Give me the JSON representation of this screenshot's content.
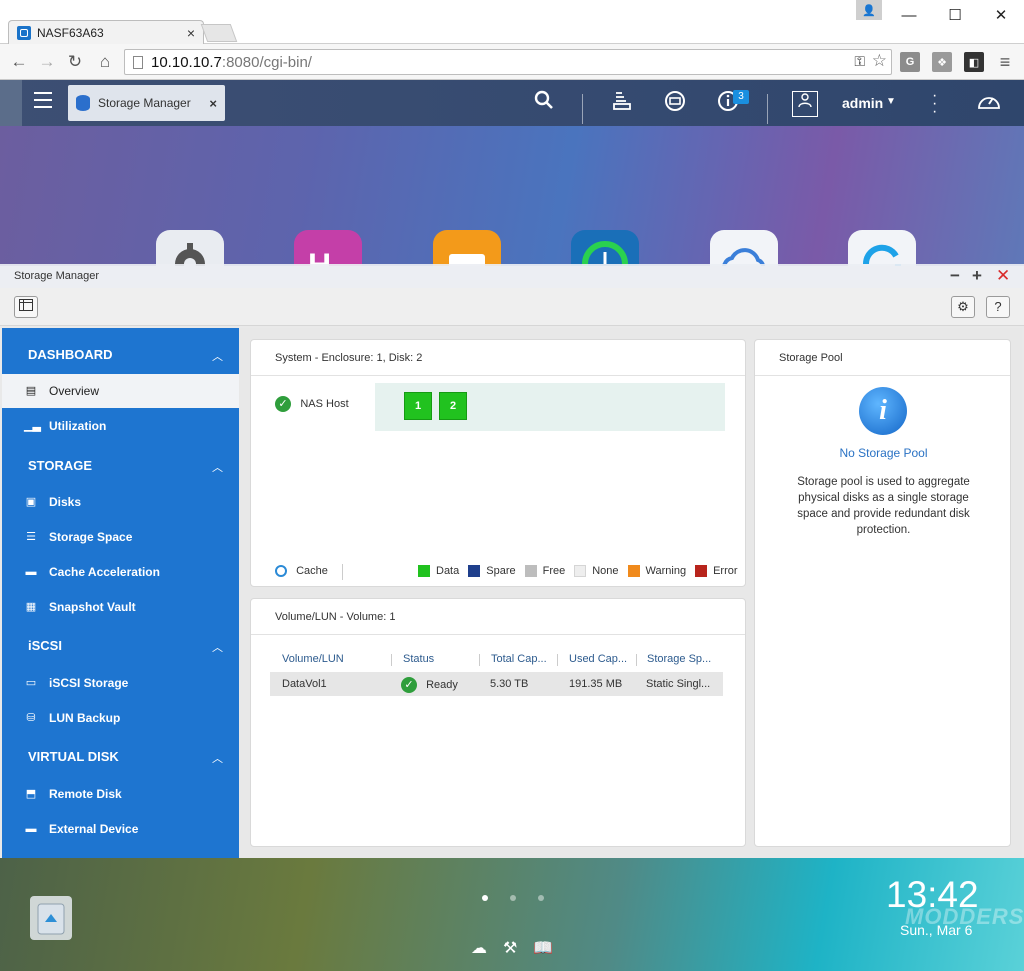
{
  "browser": {
    "tab_title": "NASF63A63",
    "url_host": "10.10.10.7",
    "url_rest": ":8080/cgi-bin/",
    "window_controls": {
      "minimize": "—",
      "maximize": "☐",
      "close": "✕"
    },
    "extensions": [
      {
        "name": "g-extension-icon",
        "glyph": "G",
        "color": "#8c8c8c"
      },
      {
        "name": "puzzle-extension-icon",
        "glyph": "❖",
        "color": "#9a9a9a"
      },
      {
        "name": "mask-extension-icon",
        "glyph": "◧",
        "color": "#333333"
      }
    ]
  },
  "qts": {
    "app_tab_title": "Storage Manager",
    "user": "admin",
    "notification_count": "3"
  },
  "window": {
    "title": "Storage Manager"
  },
  "sidebar": {
    "sections": [
      {
        "label": "DASHBOARD"
      },
      {
        "label": "STORAGE"
      },
      {
        "label": "iSCSI"
      },
      {
        "label": "VIRTUAL DISK"
      }
    ],
    "items": [
      {
        "label": "Overview",
        "icon": "overview-icon"
      },
      {
        "label": "Utilization",
        "icon": "utilization-icon"
      },
      {
        "label": "Disks",
        "icon": "disks-icon"
      },
      {
        "label": "Storage Space",
        "icon": "storage-space-icon"
      },
      {
        "label": "Cache Acceleration",
        "icon": "cache-icon"
      },
      {
        "label": "Snapshot Vault",
        "icon": "snapshot-icon"
      },
      {
        "label": "iSCSI Storage",
        "icon": "iscsi-icon"
      },
      {
        "label": "LUN Backup",
        "icon": "lun-backup-icon"
      },
      {
        "label": "Remote Disk",
        "icon": "remote-disk-icon"
      },
      {
        "label": "External Device",
        "icon": "external-device-icon"
      }
    ]
  },
  "system_panel": {
    "title": "System - Enclosure: 1, Disk: 2",
    "host_label": "NAS Host",
    "disks": [
      "1",
      "2"
    ],
    "cache_label": "Cache",
    "legend": [
      {
        "label": "Data",
        "color": "#21c21f"
      },
      {
        "label": "Spare",
        "color": "#1f3f8c"
      },
      {
        "label": "Free",
        "color": "#bdbdbd"
      },
      {
        "label": "None",
        "color": "#eeeeee"
      },
      {
        "label": "Warning",
        "color": "#f08a1c"
      },
      {
        "label": "Error",
        "color": "#b8241c"
      }
    ]
  },
  "volume_panel": {
    "title": "Volume/LUN - Volume: 1",
    "headers": [
      "Volume/LUN",
      "Status",
      "Total Cap...",
      "Used Cap...",
      "Storage Sp..."
    ],
    "rows": [
      {
        "name": "DataVol1",
        "status": "Ready",
        "total": "5.30 TB",
        "used": "191.35 MB",
        "space": "Static Singl..."
      }
    ]
  },
  "pool_panel": {
    "title": "Storage Pool",
    "heading": "No Storage Pool",
    "description": "Storage pool is used to aggregate physical disks as a single storage space and provide redundant disk protection."
  },
  "desktop": {
    "time": "13:42",
    "date": "Sun., Mar 6",
    "watermark": "MODDERS"
  }
}
